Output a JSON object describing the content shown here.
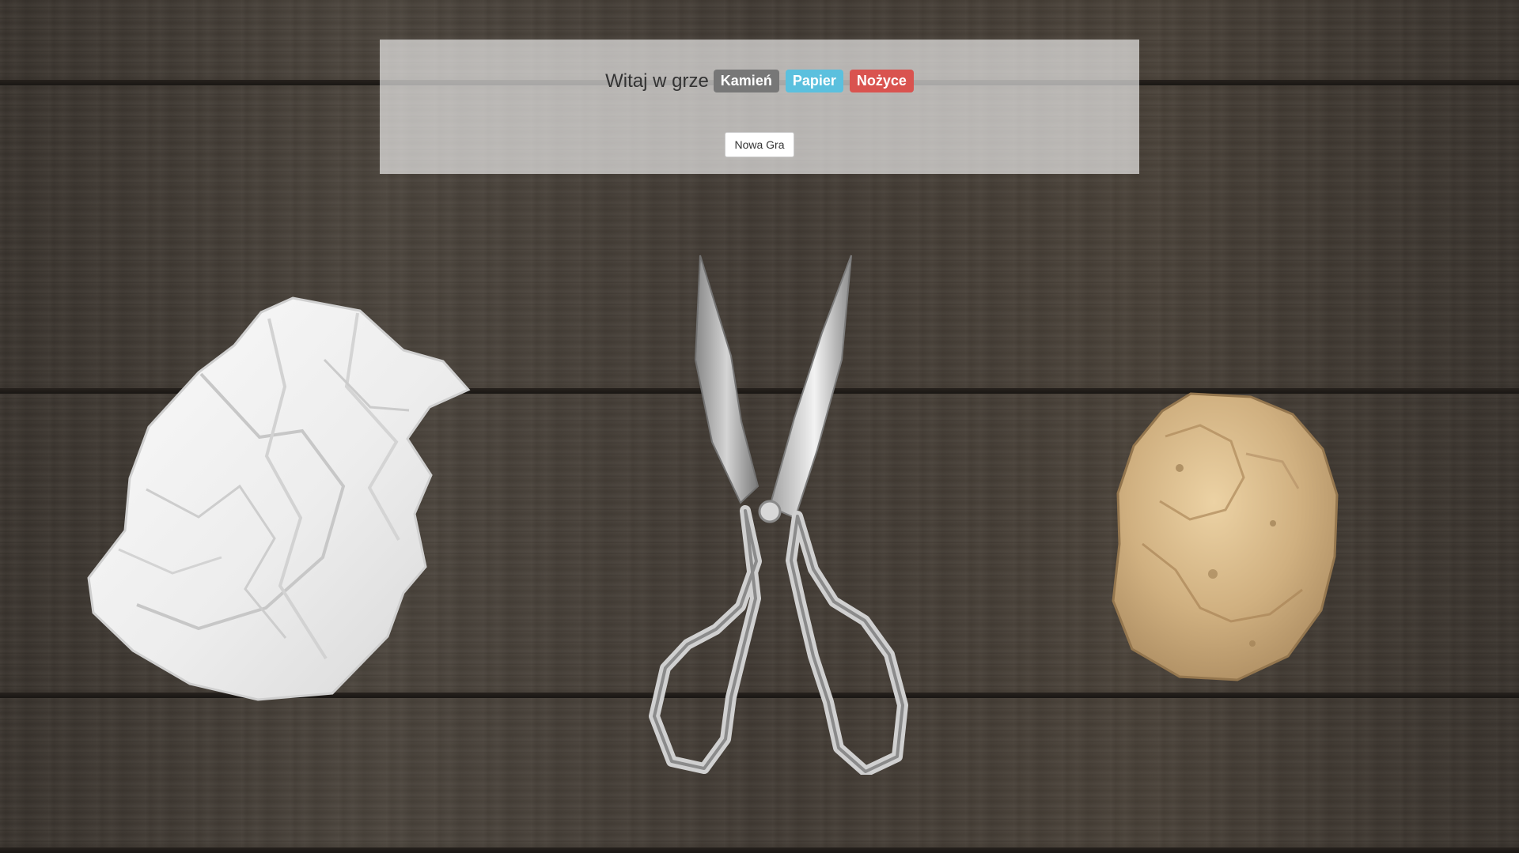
{
  "header": {
    "welcome_text": "Witaj w grze",
    "choices": [
      {
        "label": "Kamień",
        "color": "#777777"
      },
      {
        "label": "Papier",
        "color": "#5bc0de"
      },
      {
        "label": "Nożyce",
        "color": "#d9534f"
      }
    ]
  },
  "actions": {
    "new_game_label": "Nowa Gra"
  },
  "scene": {
    "objects": [
      "crumpled-paper",
      "scissors",
      "rock"
    ]
  }
}
